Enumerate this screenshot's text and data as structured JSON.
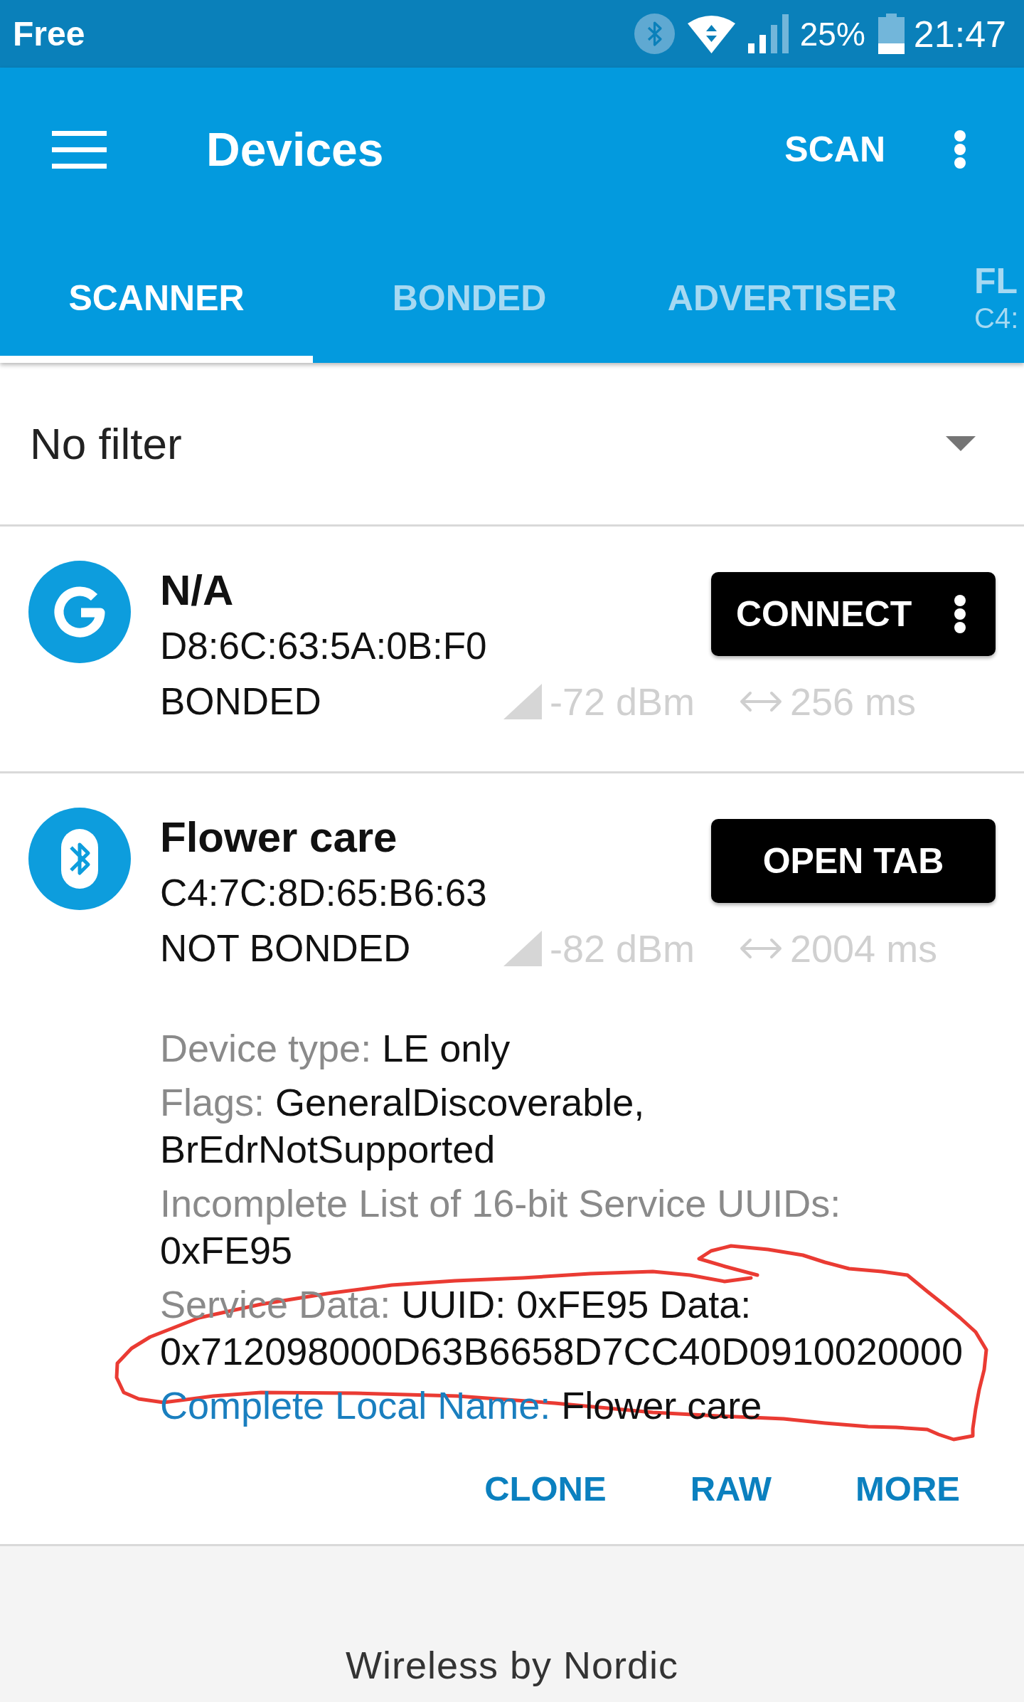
{
  "status_bar": {
    "carrier": "Free",
    "battery": "25%",
    "time": "21:47"
  },
  "app_bar": {
    "title": "Devices",
    "action": "SCAN"
  },
  "tabs": [
    {
      "label": "SCANNER",
      "selected": true
    },
    {
      "label": "BONDED",
      "selected": false
    },
    {
      "label": "ADVERTISER",
      "selected": false
    },
    {
      "label": "FL",
      "subtitle": "C4:",
      "selected": false
    }
  ],
  "filter": {
    "value": "No filter"
  },
  "devices": [
    {
      "kind": "g",
      "name": "N/A",
      "address": "D8:6C:63:5A:0B:F0",
      "bond_state": "BONDED",
      "rssi": "-72 dBm",
      "interval": "256 ms",
      "button": {
        "label": "CONNECT",
        "menu": true
      }
    },
    {
      "kind": "bluetooth",
      "name": "Flower care",
      "address": "C4:7C:8D:65:B6:63",
      "bond_state": "NOT BONDED",
      "rssi": "-82 dBm",
      "interval": "2004 ms",
      "button": {
        "label": "OPEN TAB",
        "menu": false
      },
      "details": [
        {
          "label": "Device type:",
          "value": "LE only",
          "highlighted": false
        },
        {
          "label": "Flags:",
          "value": "GeneralDiscoverable, BrEdrNotSupported",
          "highlighted": false
        },
        {
          "label": "Incomplete List of 16-bit Service UUIDs:",
          "value": "0xFE95",
          "highlighted": false
        },
        {
          "label": "Service Data:",
          "value": "UUID: 0xFE95 Data: 0x712098000D63B6658D7CC40D0910020000",
          "highlighted": false
        },
        {
          "label": "Complete Local Name:",
          "value": "Flower care",
          "highlighted": true
        }
      ],
      "actions": [
        "CLONE",
        "RAW",
        "MORE"
      ],
      "annotation": {
        "kind": "loop"
      }
    }
  ],
  "footer": "Wireless by Nordic"
}
